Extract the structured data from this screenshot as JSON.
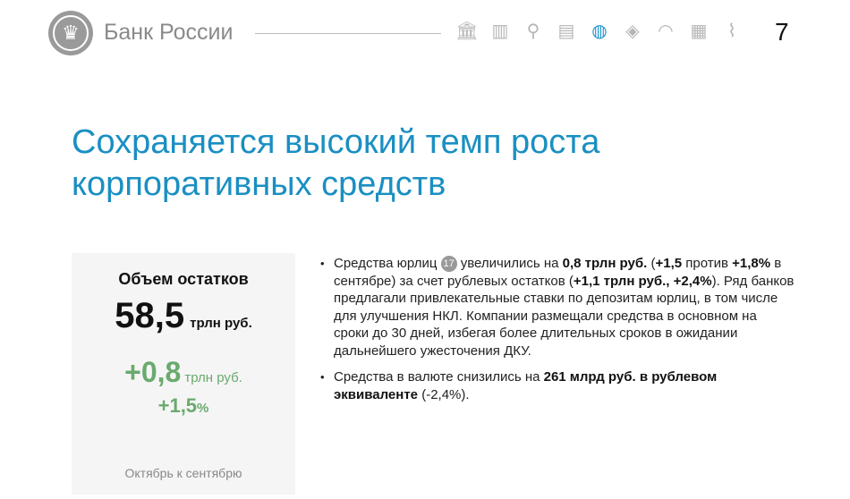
{
  "header": {
    "brand": "Банк России",
    "page_number": "7",
    "nav_icons": [
      "bank-icon",
      "factory-icon",
      "person-icon",
      "certificate-icon",
      "piggy-bank-icon",
      "banknote-icon",
      "gauge-icon",
      "gold-bars-icon",
      "paperclip-icon"
    ],
    "active_icon": "piggy-bank-icon",
    "accent": "#1a93c9"
  },
  "title": "Сохраняется высокий темп роста корпоративных средств",
  "card": {
    "heading": "Объем остатков",
    "value": "58,5",
    "unit": "трлн руб.",
    "delta": "+0,8",
    "delta_unit": "трлн руб.",
    "delta_pct": "+1,5",
    "pct_sign": "%",
    "footer": "Октябрь к сентябрю",
    "green": "#6aaa6e"
  },
  "bullets": {
    "b1": {
      "t1": "Средства юрлиц ",
      "badge": "17",
      "t2": " увеличились на ",
      "s1": "0,8 трлн руб.",
      "t3": " (",
      "s2": "+1,5",
      "t4": " против ",
      "s3": "+1,8%",
      "t5": " в сентябре) за счет рублевых остатков (",
      "s4": "+1,1 трлн руб., +2,4%",
      "t6": "). Ряд банков предлагали привлекательные ставки по депозитам юрлиц, в том числе для улучшения НКЛ. Компании размещали средства в основном на сроки до 30 дней, избегая более длительных сроков в ожидании дальнейшего ужесточения ДКУ."
    },
    "b2": {
      "t1": "Средства в валюте снизились на ",
      "s1": "261 млрд руб. в рублевом эквиваленте",
      "t2": " (-2,4%)."
    }
  }
}
